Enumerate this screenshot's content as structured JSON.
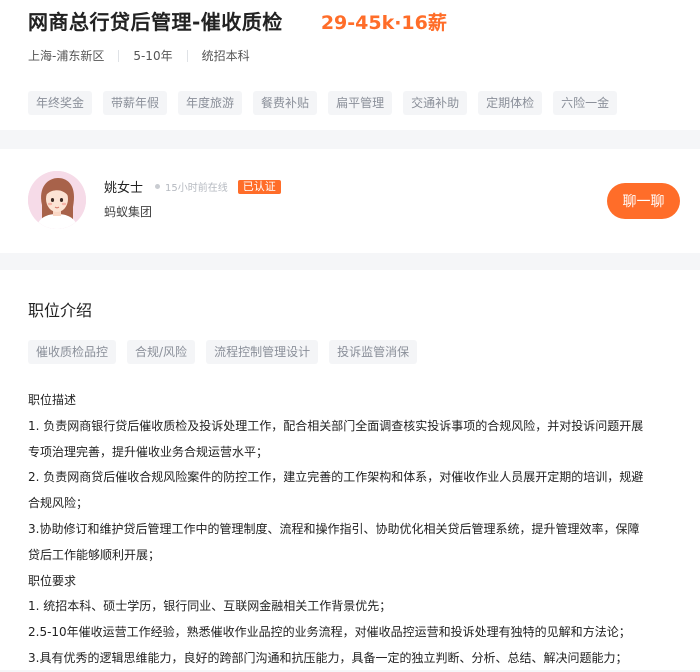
{
  "job": {
    "title": "网商总行贷后管理-催收质检",
    "salary": "29-45k·16薪",
    "location": "上海-浦东新区",
    "experience": "5-10年",
    "education": "统招本科"
  },
  "benefits": [
    "年终奖金",
    "带薪年假",
    "年度旅游",
    "餐费补贴",
    "扁平管理",
    "交通补助",
    "定期体检",
    "六险一金"
  ],
  "recruiter": {
    "name": "姚女士",
    "online_status": "15小时前在线",
    "badge": "已认证",
    "company": "蚂蚁集团",
    "chat_label": "聊一聊"
  },
  "description": {
    "section_title": "职位介绍",
    "keywords": [
      "催收质检品控",
      "合规/风险",
      "流程控制管理设计",
      "投诉监管消保"
    ],
    "lines": [
      "职位描述",
      "1. 负责网商银行贷后催收质检及投诉处理工作，配合相关部门全面调查核实投诉事项的合规风险，并对投诉问题开展\n专项治理完善，提升催收业务合规运营水平；",
      "2. 负责网商贷后催收合规风险案件的防控工作，建立完善的工作架构和体系，对催收作业人员展开定期的培训，规避\n合规风险；",
      "3.协助修订和维护贷后管理工作中的管理制度、流程和操作指引、协助优化相关贷后管理系统，提升管理效率，保障\n贷后工作能够顺利开展；",
      "职位要求",
      "1. 统招本科、硕士学历，银行同业、互联网金融相关工作背景优先；",
      "2.5-10年催收运营工作经验，熟悉催收作业品控的业务流程，对催收品控运营和投诉处理有独特的见解和方法论；",
      "3.具有优秀的逻辑思维能力，良好的跨部门沟通和抗压能力，具备一定的独立判断、分析、总结、解决问题能力；"
    ]
  }
}
